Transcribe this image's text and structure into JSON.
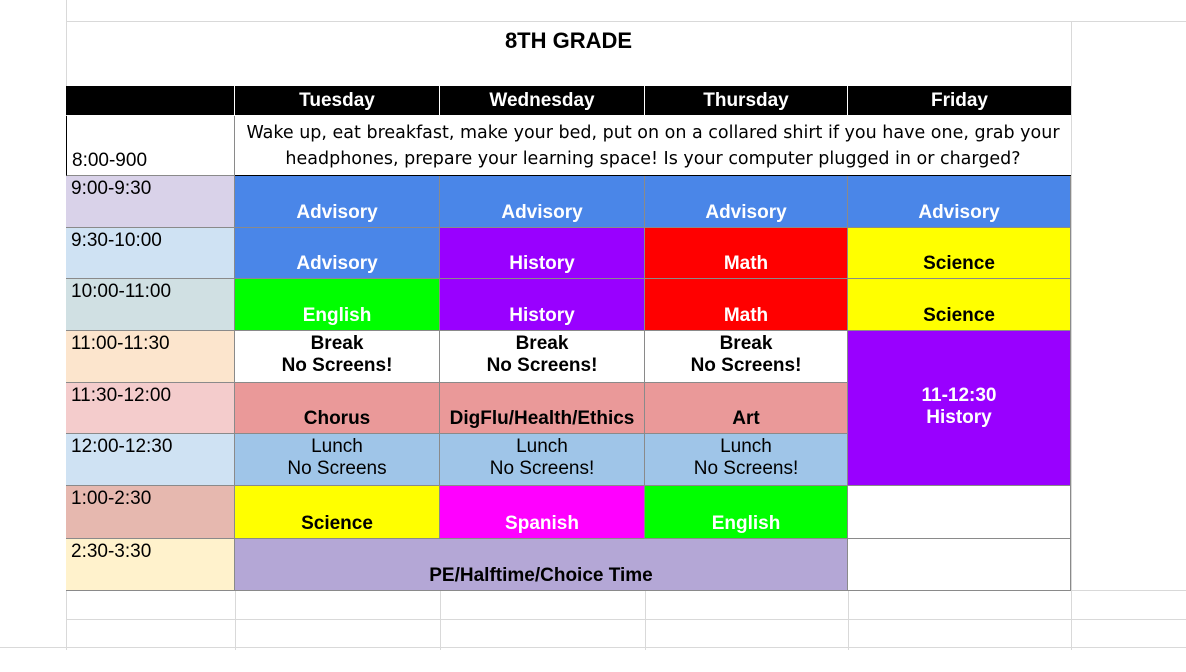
{
  "title": "8TH GRADE",
  "colors": {
    "blue": "#4a86e8",
    "purple": "#9900ff",
    "red": "#ff0000",
    "yellow": "#ffff00",
    "green": "#00ff00",
    "pink": "#ea9999",
    "light_blue": "#9fc5e8",
    "magenta": "#ff00ff",
    "lavender": "#b4a7d6"
  },
  "days": [
    "Tuesday",
    "Wednesday",
    "Thursday",
    "Friday"
  ],
  "times": [
    "8:00-900",
    "9:00-9:30",
    "9:30-10:00",
    "10:00-11:00",
    "11:00-11:30",
    "11:30-12:00",
    "12:00-12:30",
    "1:00-2:30",
    "2:30-3:30"
  ],
  "morning_note": "Wake up, eat breakfast, make your bed, put on on a collared shirt if you have one, grab your headphones, prepare your learning space! Is your computer plugged in or charged?",
  "schedule": {
    "r1": [
      "Advisory",
      "Advisory",
      "Advisory",
      "Advisory"
    ],
    "r2": [
      "Advisory",
      "History",
      "Math",
      "Science"
    ],
    "r3": [
      "English",
      "History",
      "Math",
      "Science"
    ],
    "r4": [
      {
        "l1": "Break",
        "l2": "No Screens!"
      },
      {
        "l1": "Break",
        "l2": "No Screens!"
      },
      {
        "l1": "Break",
        "l2": "No Screens!"
      }
    ],
    "r5": [
      "Chorus",
      "DigFlu/Health/Ethics",
      "Art"
    ],
    "r6": [
      {
        "l1": "Lunch",
        "l2": "No Screens"
      },
      {
        "l1": "Lunch",
        "l2": "No Screens!"
      },
      {
        "l1": "Lunch",
        "l2": "No Screens!"
      }
    ],
    "friday_block": {
      "l1": "11-12:30",
      "l2": "History"
    },
    "r7": [
      "Science",
      "Spanish",
      "English"
    ],
    "r8": "PE/Halftime/Choice Time"
  }
}
